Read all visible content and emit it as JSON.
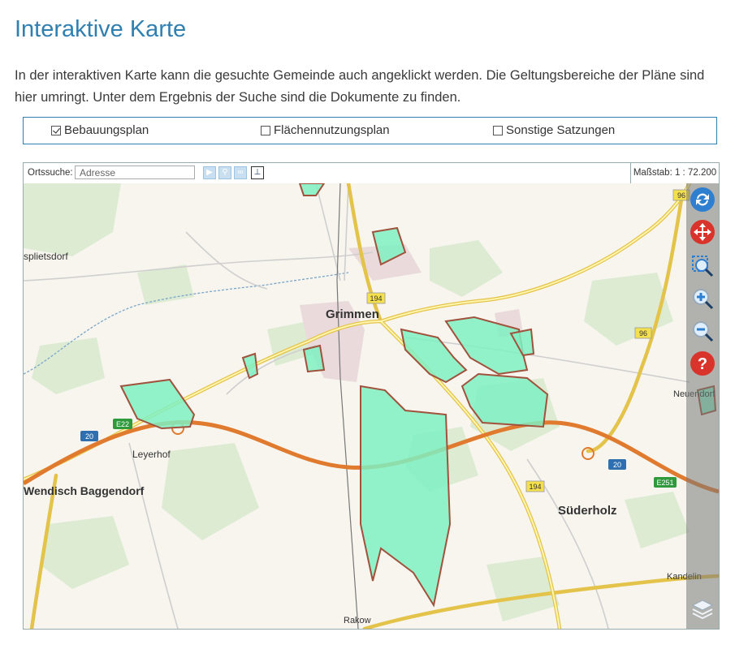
{
  "page": {
    "title": "Interaktive Karte",
    "intro": "In der interaktiven Karte kann die gesuchte Gemeinde auch angeklickt werden. Die Geltungsbereiche der Pläne sind hier umringt. Unter dem Ergebnis der Suche sind die Dokumente zu finden."
  },
  "filters": [
    {
      "label": "Bebauungsplan",
      "checked": true
    },
    {
      "label": "Flächennutzungsplan",
      "checked": false
    },
    {
      "label": "Sonstige Satzungen",
      "checked": false
    }
  ],
  "toolbar": {
    "search_label": "Ortssuche:",
    "search_placeholder": "Adresse",
    "scale_label": "Maßstab: 1 : 72.200"
  },
  "map": {
    "places": {
      "grimmen": "Grimmen",
      "spietsdorf": "splietsdorf",
      "leyerhof": "Leyerhof",
      "wendisch": "Wendisch Baggendorf",
      "suederholz": "Süderholz",
      "neuendorf": "Neuendorf",
      "kandelin": "Kandelin",
      "rakow": "Rakow"
    },
    "road_labels": {
      "b96_top": "96",
      "b96_mid": "96",
      "b194_top": "194",
      "b194_bottom": "194",
      "a20_left": "20",
      "a20_right": "20",
      "e22": "E22",
      "e251": "E251"
    },
    "colors": {
      "plan_fill": "#7ff0c2",
      "plan_border": "#a0523d",
      "motorway": "#e07a2e",
      "federal_road": "#f2e15a"
    }
  },
  "tools": [
    {
      "icon": "refresh-icon"
    },
    {
      "icon": "pan-icon"
    },
    {
      "icon": "zoom-box-icon"
    },
    {
      "icon": "zoom-in-icon"
    },
    {
      "icon": "zoom-out-icon"
    },
    {
      "icon": "help-icon"
    },
    {
      "icon": "layers-icon"
    }
  ]
}
